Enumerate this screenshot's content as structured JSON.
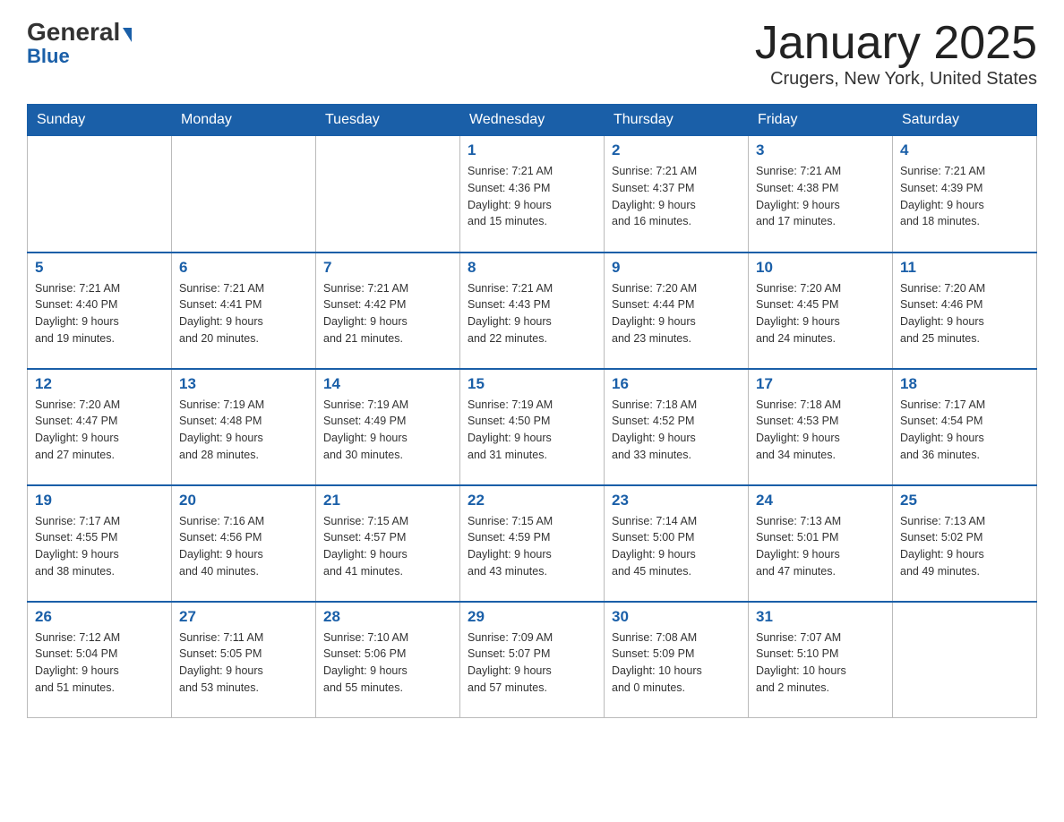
{
  "header": {
    "logo_general": "General",
    "logo_blue": "Blue",
    "title": "January 2025",
    "subtitle": "Crugers, New York, United States"
  },
  "days_of_week": [
    "Sunday",
    "Monday",
    "Tuesday",
    "Wednesday",
    "Thursday",
    "Friday",
    "Saturday"
  ],
  "weeks": [
    [
      {
        "day": "",
        "info": ""
      },
      {
        "day": "",
        "info": ""
      },
      {
        "day": "",
        "info": ""
      },
      {
        "day": "1",
        "info": "Sunrise: 7:21 AM\nSunset: 4:36 PM\nDaylight: 9 hours\nand 15 minutes."
      },
      {
        "day": "2",
        "info": "Sunrise: 7:21 AM\nSunset: 4:37 PM\nDaylight: 9 hours\nand 16 minutes."
      },
      {
        "day": "3",
        "info": "Sunrise: 7:21 AM\nSunset: 4:38 PM\nDaylight: 9 hours\nand 17 minutes."
      },
      {
        "day": "4",
        "info": "Sunrise: 7:21 AM\nSunset: 4:39 PM\nDaylight: 9 hours\nand 18 minutes."
      }
    ],
    [
      {
        "day": "5",
        "info": "Sunrise: 7:21 AM\nSunset: 4:40 PM\nDaylight: 9 hours\nand 19 minutes."
      },
      {
        "day": "6",
        "info": "Sunrise: 7:21 AM\nSunset: 4:41 PM\nDaylight: 9 hours\nand 20 minutes."
      },
      {
        "day": "7",
        "info": "Sunrise: 7:21 AM\nSunset: 4:42 PM\nDaylight: 9 hours\nand 21 minutes."
      },
      {
        "day": "8",
        "info": "Sunrise: 7:21 AM\nSunset: 4:43 PM\nDaylight: 9 hours\nand 22 minutes."
      },
      {
        "day": "9",
        "info": "Sunrise: 7:20 AM\nSunset: 4:44 PM\nDaylight: 9 hours\nand 23 minutes."
      },
      {
        "day": "10",
        "info": "Sunrise: 7:20 AM\nSunset: 4:45 PM\nDaylight: 9 hours\nand 24 minutes."
      },
      {
        "day": "11",
        "info": "Sunrise: 7:20 AM\nSunset: 4:46 PM\nDaylight: 9 hours\nand 25 minutes."
      }
    ],
    [
      {
        "day": "12",
        "info": "Sunrise: 7:20 AM\nSunset: 4:47 PM\nDaylight: 9 hours\nand 27 minutes."
      },
      {
        "day": "13",
        "info": "Sunrise: 7:19 AM\nSunset: 4:48 PM\nDaylight: 9 hours\nand 28 minutes."
      },
      {
        "day": "14",
        "info": "Sunrise: 7:19 AM\nSunset: 4:49 PM\nDaylight: 9 hours\nand 30 minutes."
      },
      {
        "day": "15",
        "info": "Sunrise: 7:19 AM\nSunset: 4:50 PM\nDaylight: 9 hours\nand 31 minutes."
      },
      {
        "day": "16",
        "info": "Sunrise: 7:18 AM\nSunset: 4:52 PM\nDaylight: 9 hours\nand 33 minutes."
      },
      {
        "day": "17",
        "info": "Sunrise: 7:18 AM\nSunset: 4:53 PM\nDaylight: 9 hours\nand 34 minutes."
      },
      {
        "day": "18",
        "info": "Sunrise: 7:17 AM\nSunset: 4:54 PM\nDaylight: 9 hours\nand 36 minutes."
      }
    ],
    [
      {
        "day": "19",
        "info": "Sunrise: 7:17 AM\nSunset: 4:55 PM\nDaylight: 9 hours\nand 38 minutes."
      },
      {
        "day": "20",
        "info": "Sunrise: 7:16 AM\nSunset: 4:56 PM\nDaylight: 9 hours\nand 40 minutes."
      },
      {
        "day": "21",
        "info": "Sunrise: 7:15 AM\nSunset: 4:57 PM\nDaylight: 9 hours\nand 41 minutes."
      },
      {
        "day": "22",
        "info": "Sunrise: 7:15 AM\nSunset: 4:59 PM\nDaylight: 9 hours\nand 43 minutes."
      },
      {
        "day": "23",
        "info": "Sunrise: 7:14 AM\nSunset: 5:00 PM\nDaylight: 9 hours\nand 45 minutes."
      },
      {
        "day": "24",
        "info": "Sunrise: 7:13 AM\nSunset: 5:01 PM\nDaylight: 9 hours\nand 47 minutes."
      },
      {
        "day": "25",
        "info": "Sunrise: 7:13 AM\nSunset: 5:02 PM\nDaylight: 9 hours\nand 49 minutes."
      }
    ],
    [
      {
        "day": "26",
        "info": "Sunrise: 7:12 AM\nSunset: 5:04 PM\nDaylight: 9 hours\nand 51 minutes."
      },
      {
        "day": "27",
        "info": "Sunrise: 7:11 AM\nSunset: 5:05 PM\nDaylight: 9 hours\nand 53 minutes."
      },
      {
        "day": "28",
        "info": "Sunrise: 7:10 AM\nSunset: 5:06 PM\nDaylight: 9 hours\nand 55 minutes."
      },
      {
        "day": "29",
        "info": "Sunrise: 7:09 AM\nSunset: 5:07 PM\nDaylight: 9 hours\nand 57 minutes."
      },
      {
        "day": "30",
        "info": "Sunrise: 7:08 AM\nSunset: 5:09 PM\nDaylight: 10 hours\nand 0 minutes."
      },
      {
        "day": "31",
        "info": "Sunrise: 7:07 AM\nSunset: 5:10 PM\nDaylight: 10 hours\nand 2 minutes."
      },
      {
        "day": "",
        "info": ""
      }
    ]
  ]
}
